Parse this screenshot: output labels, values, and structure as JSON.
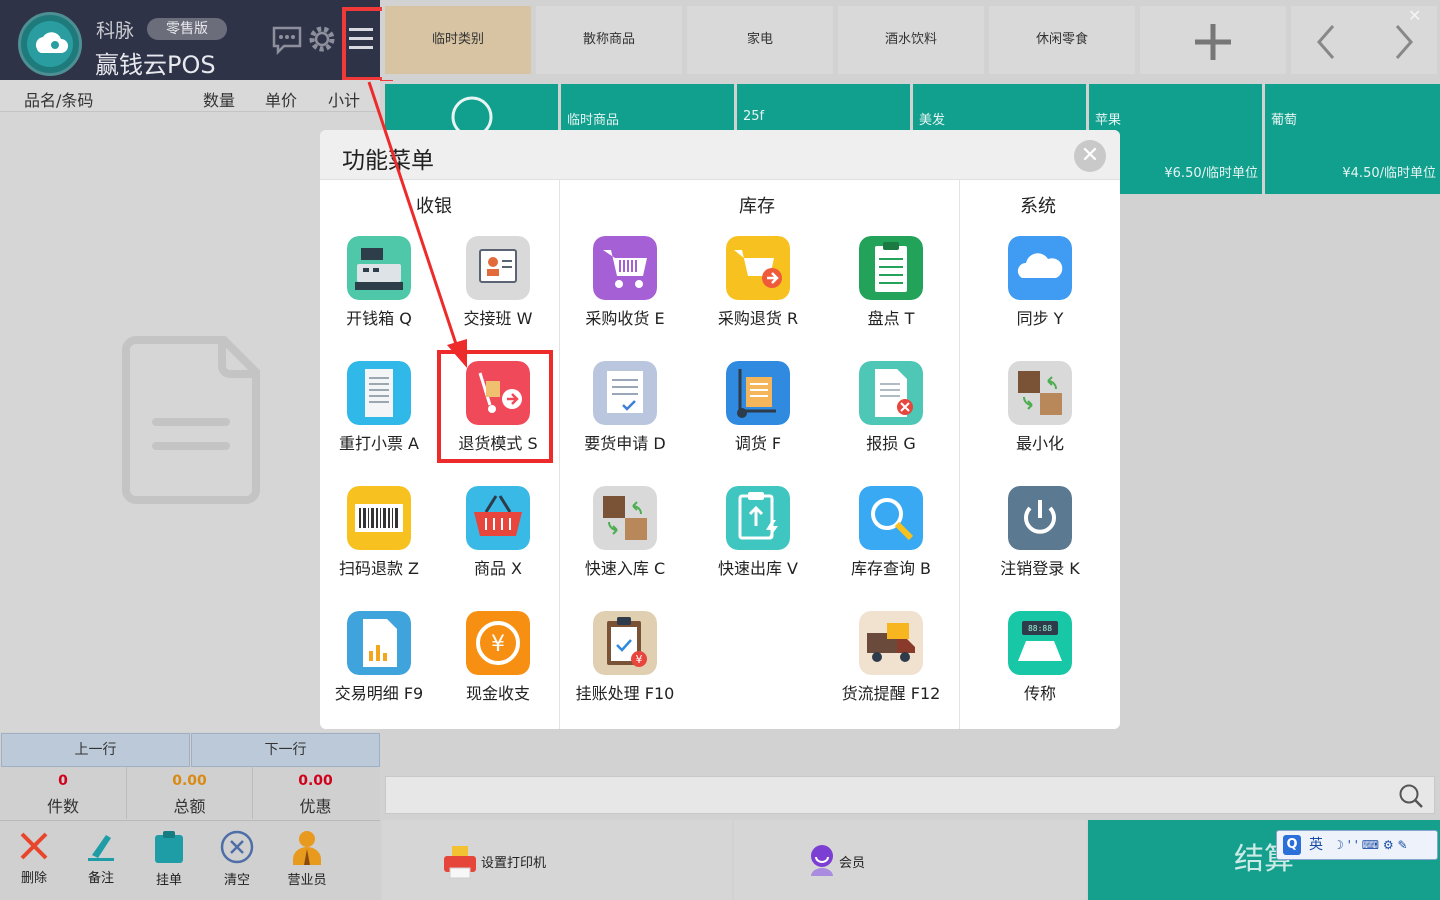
{
  "header": {
    "brand": "科脉",
    "edition": "零售版",
    "app_name": "赢钱云POS"
  },
  "cart": {
    "col_name": "品名/条码",
    "col_qty": "数量",
    "col_price": "单价",
    "col_subtotal": "小计"
  },
  "nav": {
    "prev": "上一行",
    "next": "下一行"
  },
  "stats": [
    {
      "value": "0",
      "label": "件数"
    },
    {
      "value": "0.00",
      "label": "总额"
    },
    {
      "value": "0.00",
      "label": "优惠"
    }
  ],
  "toolbar": {
    "delete": "删除",
    "note": "备注",
    "hold": "挂单",
    "clear": "清空",
    "clerk": "营业员"
  },
  "categories": [
    "临时类别",
    "散称商品",
    "家电",
    "酒水饮料",
    "休闲零食"
  ],
  "products": [
    {
      "name": "",
      "price": ""
    },
    {
      "name": "临时商品",
      "price": ""
    },
    {
      "name": "25f",
      "price": ""
    },
    {
      "name": "美发",
      "price": ""
    },
    {
      "name": "苹果",
      "price": "¥6.50/临时单位"
    },
    {
      "name": "葡萄",
      "price": "¥4.50/临时单位"
    }
  ],
  "bottom": {
    "printer": "设置打印机",
    "member": "会员",
    "checkout": "结算"
  },
  "ime": {
    "label": "英"
  },
  "modal": {
    "title": "功能菜单",
    "sections": {
      "cashier": "收银",
      "inventory": "库存",
      "system": "系统"
    },
    "items": {
      "open_drawer": "开钱箱 Q",
      "shift": "交接班 W",
      "reprint": "重打小票 A",
      "return_mode": "退货模式 S",
      "scan_refund": "扫码退款 Z",
      "goods": "商品 X",
      "trade_detail": "交易明细 F9",
      "cash": "现金收支",
      "purchase_receive": "采购收货 E",
      "purchase_return": "采购退货 R",
      "stocktake": "盘点 T",
      "requisition": "要货申请 D",
      "transfer": "调货 F",
      "loss": "报损 G",
      "quick_in": "快速入库 C",
      "quick_out": "快速出库 V",
      "stock_query": "库存查询 B",
      "credit": "挂账处理 F10",
      "logistics": "货流提醒 F12",
      "sync": "同步 Y",
      "minimize": "最小化",
      "logout": "注销登录 K",
      "scale": "传称"
    }
  },
  "colors": {
    "header_bg": "#2e3347",
    "teal": "#11a08e",
    "highlight_red": "#ee2b2b",
    "active_category": "#d8c4a3"
  }
}
